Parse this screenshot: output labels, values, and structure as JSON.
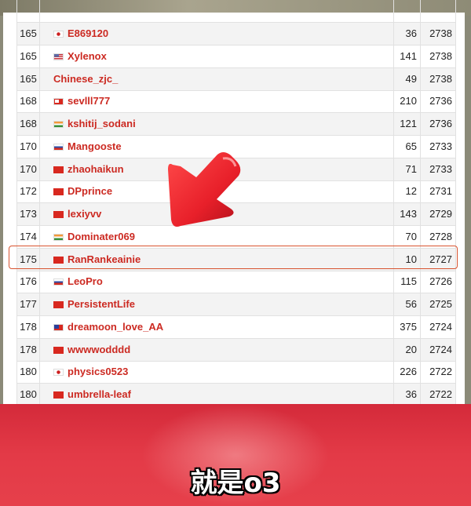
{
  "ranking": {
    "rows": [
      {
        "rank": "165",
        "flag": "jp",
        "handle": "E869120",
        "solved": "36",
        "rating": "2738"
      },
      {
        "rank": "165",
        "flag": "us",
        "handle": "Xylenox",
        "solved": "141",
        "rating": "2738"
      },
      {
        "rank": "165",
        "flag": "",
        "handle": "Chinese_zjc_",
        "solved": "49",
        "rating": "2738"
      },
      {
        "rank": "168",
        "flag": "to",
        "handle": "sevlll777",
        "solved": "210",
        "rating": "2736"
      },
      {
        "rank": "168",
        "flag": "in",
        "handle": "kshitij_sodani",
        "solved": "121",
        "rating": "2736"
      },
      {
        "rank": "170",
        "flag": "ru",
        "handle": "Mangooste",
        "solved": "65",
        "rating": "2733"
      },
      {
        "rank": "170",
        "flag": "cn",
        "handle": "zhaohaikun",
        "solved": "71",
        "rating": "2733"
      },
      {
        "rank": "172",
        "flag": "cn",
        "handle": "DPprince",
        "solved": "12",
        "rating": "2731"
      },
      {
        "rank": "173",
        "flag": "cn",
        "handle": "lexiyvv",
        "solved": "143",
        "rating": "2729"
      },
      {
        "rank": "174",
        "flag": "in",
        "handle": "Dominater069",
        "solved": "70",
        "rating": "2728"
      },
      {
        "rank": "175",
        "flag": "cn",
        "handle": "RanRankeainie",
        "solved": "10",
        "rating": "2727",
        "highlighted": true
      },
      {
        "rank": "176",
        "flag": "ru",
        "handle": "LeoPro",
        "solved": "115",
        "rating": "2726"
      },
      {
        "rank": "177",
        "flag": "cn",
        "handle": "PersistentLife",
        "solved": "56",
        "rating": "2725"
      },
      {
        "rank": "178",
        "flag": "tw",
        "handle": "dreamoon_love_AA",
        "solved": "375",
        "rating": "2724"
      },
      {
        "rank": "178",
        "flag": "cn",
        "handle": "wwwwodddd",
        "solved": "20",
        "rating": "2724"
      },
      {
        "rank": "180",
        "flag": "jp",
        "handle": "physics0523",
        "solved": "226",
        "rating": "2722"
      },
      {
        "rank": "180",
        "flag": "cn",
        "handle": "umbrella-leaf",
        "solved": "36",
        "rating": "2722"
      }
    ]
  },
  "overlay": {
    "arrow_icon": "red-3d-arrow-pointing-down-left",
    "arrow_color": "#e8202a",
    "highlight_color": "#d8532f",
    "subtitle": "就是o3"
  },
  "colors": {
    "handle": "#cc2a22",
    "band": "#e33a47"
  }
}
